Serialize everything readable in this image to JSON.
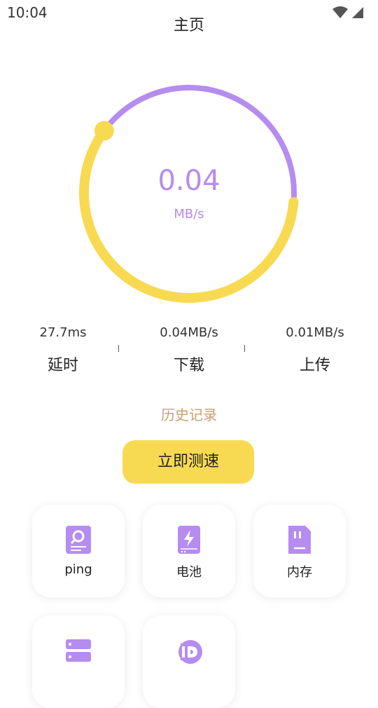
{
  "status_bar": {
    "time": "10:04"
  },
  "header": {
    "title": "主页"
  },
  "gauge": {
    "value": "0.04",
    "unit": "MB/s",
    "progress": 0.85,
    "accent_color": "#b58cf0",
    "track_color": "#f8da52"
  },
  "stats": [
    {
      "value": "27.7ms",
      "label": "延时"
    },
    {
      "value": "0.04MB/s",
      "label": "下载"
    },
    {
      "value": "0.01MB/s",
      "label": "上传"
    }
  ],
  "history": {
    "label": "历史记录"
  },
  "speedtest_button": {
    "label": "立即测速"
  },
  "tools": [
    {
      "label": "ping",
      "icon": "ping-icon"
    },
    {
      "label": "电池",
      "icon": "battery-icon"
    },
    {
      "label": "内存",
      "icon": "memory-icon"
    },
    {
      "label": "",
      "icon": "storage-icon"
    },
    {
      "label": "",
      "icon": "ip-icon"
    }
  ]
}
